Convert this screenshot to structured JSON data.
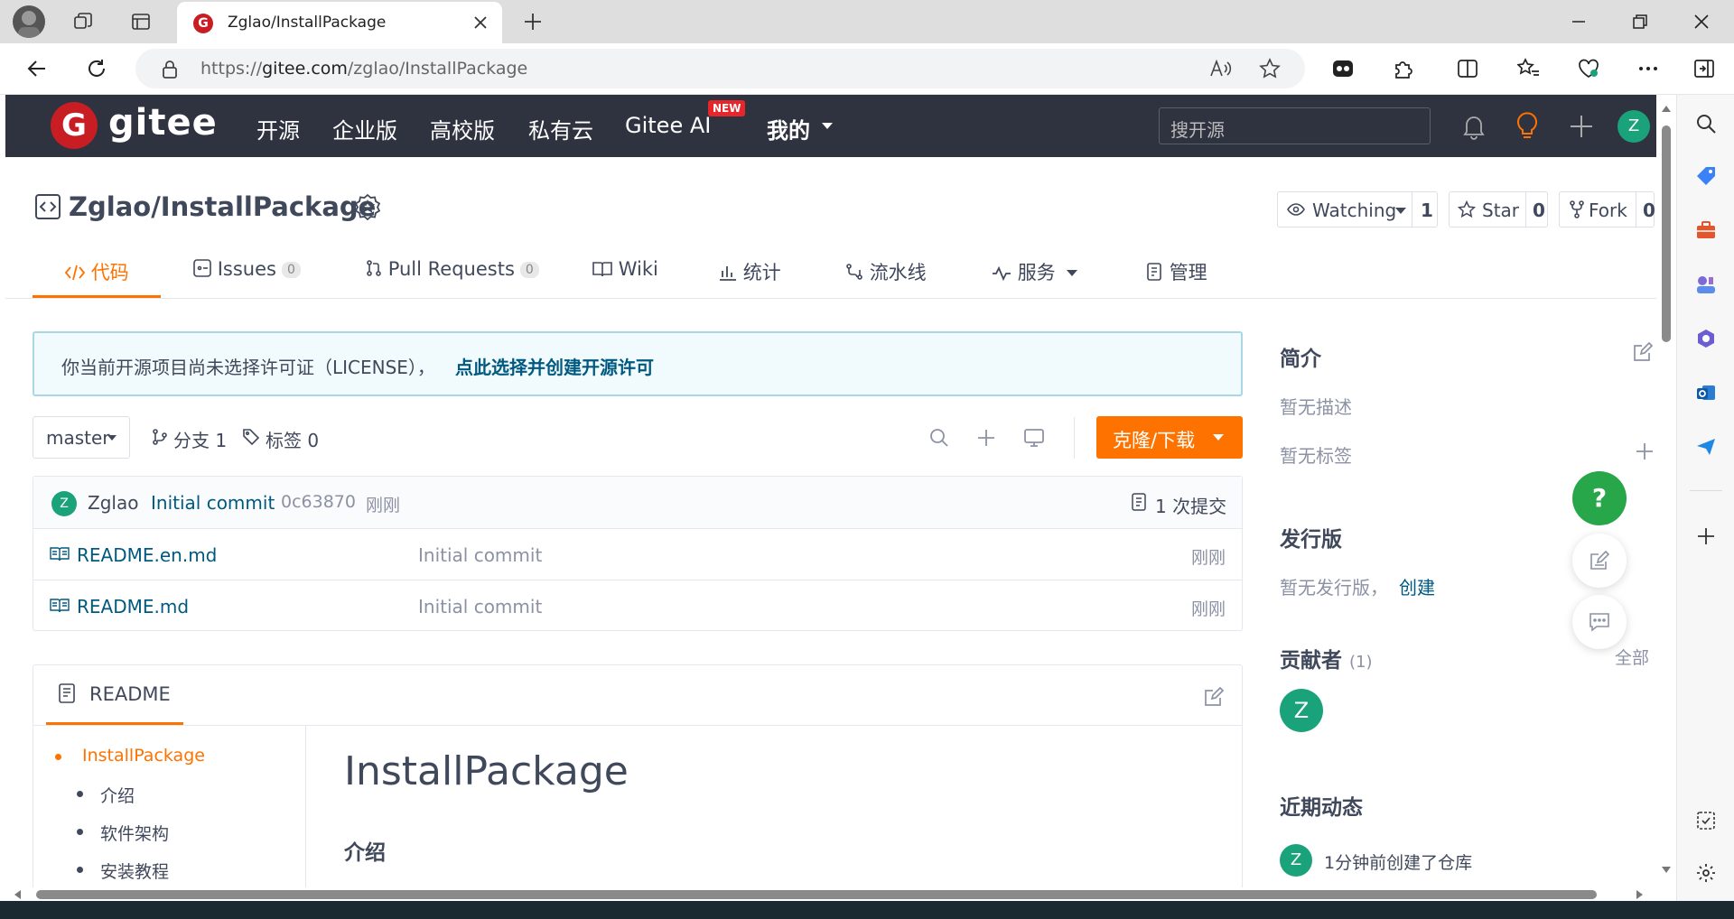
{
  "browser": {
    "tab_title": "Zglao/InstallPackage",
    "url_prefix": "https://",
    "url_domain": "gitee.com",
    "url_path": "/zglao/InstallPackage"
  },
  "gitee": {
    "logo_text": "gitee",
    "nav": [
      "开源",
      "企业版",
      "高校版",
      "私有云",
      "Gitee AI",
      "我的"
    ],
    "new_badge": "NEW",
    "search_placeholder": "搜开源",
    "avatar_letter": "Z"
  },
  "repo": {
    "title": "Zglao/InstallPackage",
    "watching_label": "Watching",
    "watching_count": "1",
    "star_label": "Star",
    "star_count": "0",
    "fork_label": "Fork",
    "fork_count": "0"
  },
  "tabs": [
    {
      "label": "代码"
    },
    {
      "label": "Issues",
      "count": "0"
    },
    {
      "label": "Pull Requests",
      "count": "0"
    },
    {
      "label": "Wiki"
    },
    {
      "label": "统计"
    },
    {
      "label": "流水线"
    },
    {
      "label": "服务"
    },
    {
      "label": "管理"
    }
  ],
  "license": {
    "text": "你当前开源项目尚未选择许可证（LICENSE），",
    "link": "点此选择并创建开源许可"
  },
  "branch": {
    "name": "master",
    "branches": "分支 1",
    "tags": "标签 0",
    "clone_label": "克隆/下载"
  },
  "commit": {
    "avatar": "Z",
    "author": "Zglao",
    "message": "Initial commit",
    "hash": "0c63870",
    "time": "刚刚",
    "count": "1 次提交"
  },
  "files": [
    {
      "name": "README.en.md",
      "message": "Initial commit",
      "time": "刚刚"
    },
    {
      "name": "README.md",
      "message": "Initial commit",
      "time": "刚刚"
    }
  ],
  "readme": {
    "tab": "README",
    "toc": [
      "InstallPackage",
      "介绍",
      "软件架构",
      "安装教程"
    ],
    "h1": "InstallPackage",
    "h2": "介绍"
  },
  "sidebar": {
    "intro_title": "简介",
    "no_desc": "暂无描述",
    "no_tags": "暂无标签",
    "release_title": "发行版",
    "no_release": "暂无发行版，",
    "create_link": "创建",
    "contrib_title": "贡献者",
    "contrib_count": "(1)",
    "all_link": "全部",
    "contrib_avatar": "Z",
    "activity_title": "近期动态",
    "activity_avatar": "Z",
    "activity_text": "1分钟前创建了仓库"
  },
  "float_help": "?"
}
